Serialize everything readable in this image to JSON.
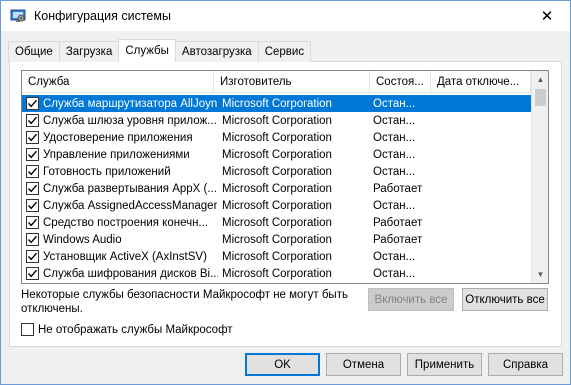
{
  "window": {
    "title": "Конфигурация системы",
    "close_glyph": "✕"
  },
  "tabs": [
    {
      "label": "Общие"
    },
    {
      "label": "Загрузка"
    },
    {
      "label": "Службы",
      "active": true
    },
    {
      "label": "Автозагрузка"
    },
    {
      "label": "Сервис"
    }
  ],
  "services": {
    "columns": {
      "service": "Служба",
      "manufacturer": "Изготовитель",
      "status": "Состоя...",
      "disabled_date": "Дата отключе..."
    },
    "rows": [
      {
        "name": "Служба маршрутизатора AllJoyn",
        "manufacturer": "Microsoft Corporation",
        "status": "Остан...",
        "date": "",
        "checked": true,
        "selected": true
      },
      {
        "name": "Служба шлюза уровня прилож...",
        "manufacturer": "Microsoft Corporation",
        "status": "Остан...",
        "date": "",
        "checked": true
      },
      {
        "name": "Удостоверение приложения",
        "manufacturer": "Microsoft Corporation",
        "status": "Остан...",
        "date": "",
        "checked": true
      },
      {
        "name": "Управление приложениями",
        "manufacturer": "Microsoft Corporation",
        "status": "Остан...",
        "date": "",
        "checked": true
      },
      {
        "name": "Готовность приложений",
        "manufacturer": "Microsoft Corporation",
        "status": "Остан...",
        "date": "",
        "checked": true
      },
      {
        "name": "Служба развертывания AppX (...",
        "manufacturer": "Microsoft Corporation",
        "status": "Работает",
        "date": "",
        "checked": true
      },
      {
        "name": "Служба AssignedAccessManager",
        "manufacturer": "Microsoft Corporation",
        "status": "Остан...",
        "date": "",
        "checked": true
      },
      {
        "name": "Средство построения конечн...",
        "manufacturer": "Microsoft Corporation",
        "status": "Работает",
        "date": "",
        "checked": true
      },
      {
        "name": "Windows Audio",
        "manufacturer": "Microsoft Corporation",
        "status": "Работает",
        "date": "",
        "checked": true
      },
      {
        "name": "Установщик ActiveX (AxInstSV)",
        "manufacturer": "Microsoft Corporation",
        "status": "Остан...",
        "date": "",
        "checked": true
      },
      {
        "name": "Служба шифрования дисков Bi...",
        "manufacturer": "Microsoft Corporation",
        "status": "Остан...",
        "date": "",
        "checked": true
      }
    ]
  },
  "note": "Некоторые службы безопасности Майкрософт не могут быть отключены.",
  "buttons": {
    "enable_all": "Включить все",
    "disable_all": "Отключить все",
    "ok": "OK",
    "cancel": "Отмена",
    "apply": "Применить",
    "help": "Справка"
  },
  "hide_ms": {
    "label": "Не отображать службы Майкрософт",
    "checked": false
  },
  "colors": {
    "selection": "#0078d7",
    "default_button_border": "#0078d7"
  }
}
